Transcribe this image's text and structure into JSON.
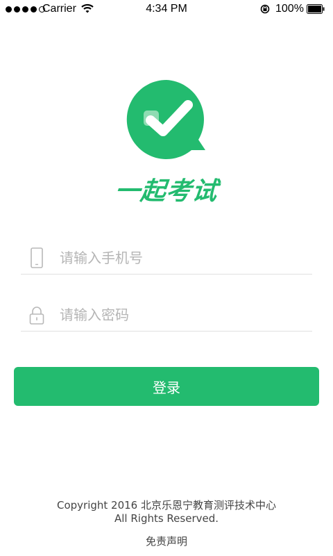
{
  "status_bar": {
    "carrier": "Carrier",
    "time": "4:34 PM",
    "battery": "100%"
  },
  "brand": {
    "app_name": "一起考试",
    "accent_color": "#23bb6f",
    "logo_icon": "checkmark-chat-bubble-icon"
  },
  "login_form": {
    "phone_placeholder": "请输入手机号",
    "phone_icon": "phone-icon",
    "password_placeholder": "请输入密码",
    "password_icon": "lock-icon",
    "login_label": "登录"
  },
  "footer": {
    "copyright_line1": "Copyright 2016 北京乐恩宁教育测评技术中心",
    "copyright_line2": "All Rights Reserved.",
    "disclaimer": "免责声明"
  }
}
